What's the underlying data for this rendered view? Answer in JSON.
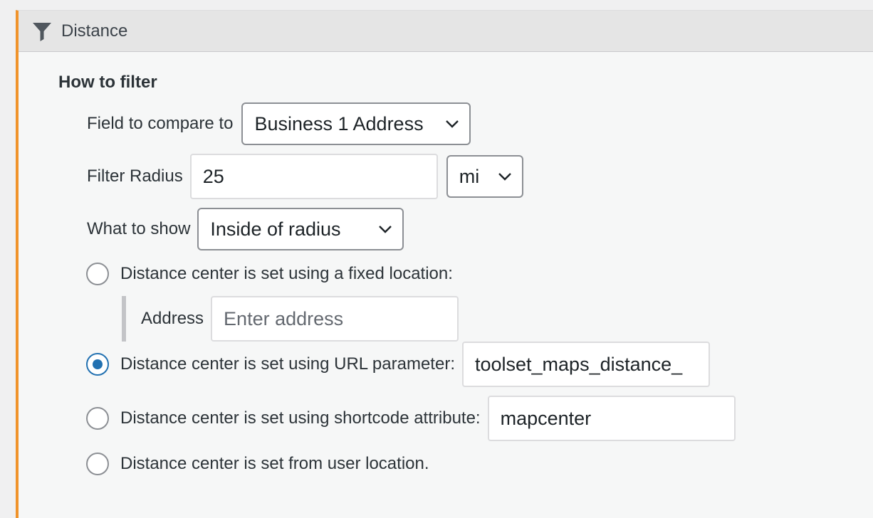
{
  "panel": {
    "title": "Distance",
    "icon": "filter-icon",
    "accent_color": "#f0932b"
  },
  "how_to_filter": {
    "heading": "How to filter",
    "field_compare": {
      "label": "Field to compare to",
      "value": "Business 1 Address"
    },
    "radius": {
      "label": "Filter Radius",
      "value": "25",
      "unit": "mi"
    },
    "what_to_show": {
      "label": "What to show",
      "value": "Inside of radius"
    }
  },
  "center_options": [
    {
      "label": "Distance center is set using a fixed location:",
      "checked": false
    },
    {
      "label": "Distance center is set using URL parameter:",
      "checked": true,
      "value": "toolset_maps_distance_"
    },
    {
      "label": "Distance center is set using shortcode attribute:",
      "checked": false,
      "value": "mapcenter"
    },
    {
      "label": "Distance center is set from user location.",
      "checked": false
    }
  ],
  "address": {
    "label": "Address",
    "placeholder": "Enter address"
  }
}
